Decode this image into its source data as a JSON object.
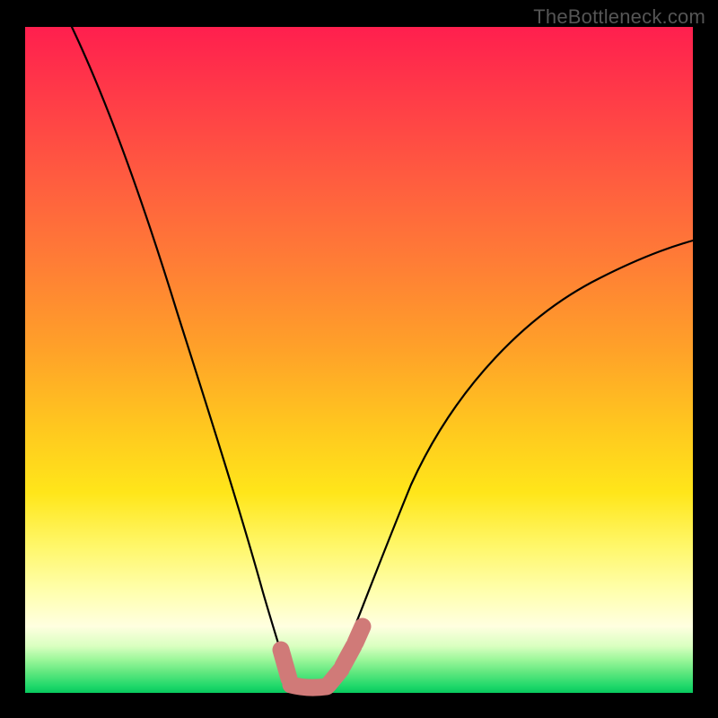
{
  "watermark": "TheBottleneck.com",
  "chart_data": {
    "type": "line",
    "title": "",
    "xlabel": "",
    "ylabel": "",
    "xlim": [
      0,
      100
    ],
    "ylim": [
      0,
      100
    ],
    "grid": false,
    "legend": false,
    "background_gradient": {
      "direction": "vertical",
      "stops": [
        {
          "pos": 0,
          "color": "#ff1f4e"
        },
        {
          "pos": 50,
          "color": "#ffa029"
        },
        {
          "pos": 80,
          "color": "#fff76a"
        },
        {
          "pos": 95,
          "color": "#9cf79a"
        },
        {
          "pos": 100,
          "color": "#08c85e"
        }
      ]
    },
    "series": [
      {
        "name": "left-curve",
        "x": [
          7,
          12,
          17,
          22,
          27,
          32,
          35,
          38,
          39.5
        ],
        "y": [
          100,
          90,
          75,
          58,
          40,
          22,
          12,
          5,
          2
        ]
      },
      {
        "name": "right-curve",
        "x": [
          46.5,
          49,
          53,
          60,
          70,
          82,
          94,
          100
        ],
        "y": [
          3,
          8,
          18,
          33,
          48,
          58,
          64,
          67
        ]
      }
    ],
    "annotations": [
      {
        "name": "valley-marker",
        "type": "highlight-stroke",
        "description": "salmon colored thick marker along valley bottom, J-shaped",
        "points_xy": [
          [
            38.5,
            6.5
          ],
          [
            39.5,
            2.5
          ],
          [
            41,
            1
          ],
          [
            43,
            0.8
          ],
          [
            45,
            1
          ],
          [
            46.5,
            2.5
          ],
          [
            48,
            6
          ],
          [
            49.5,
            10
          ]
        ]
      }
    ]
  },
  "colors": {
    "black": "#000000",
    "marker": "#d07a78"
  }
}
